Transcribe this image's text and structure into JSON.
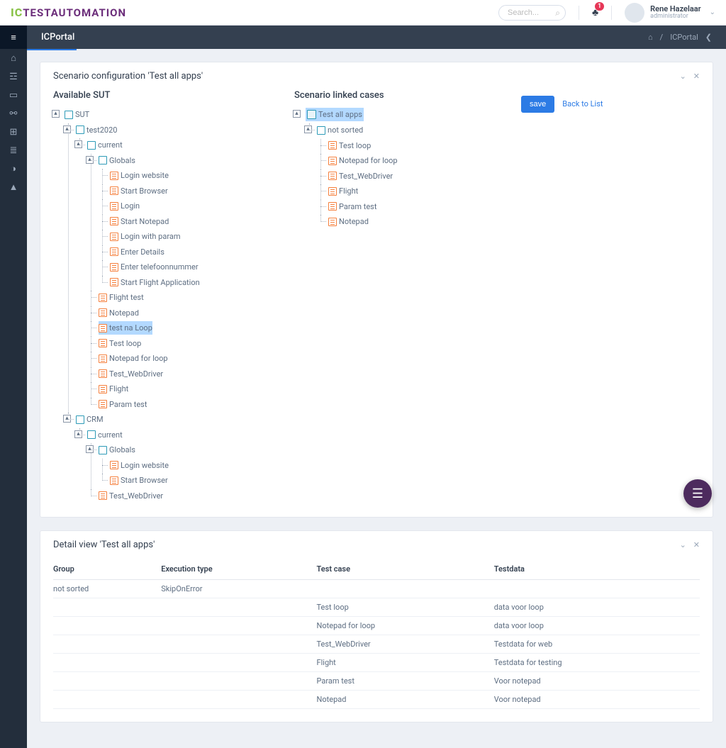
{
  "brand": {
    "ic": "IC",
    "text": "TESTAUTOMATION"
  },
  "search": {
    "placeholder": "Search..."
  },
  "notifications": {
    "count": "1"
  },
  "user": {
    "name": "Rene Hazelaar",
    "role": "administrator"
  },
  "page": {
    "title": "ICPortal"
  },
  "breadcrumb": {
    "home": "⌂",
    "sep": "/",
    "current": "ICPortal"
  },
  "card1": {
    "title": "Scenario configuration 'Test all apps'"
  },
  "avail": {
    "title": "Available SUT",
    "root": "SUT",
    "n1": "test2020",
    "n2": "current",
    "n3": "Globals",
    "g": [
      "Login website",
      "Start Browser",
      "Login",
      "Start Notepad",
      "Login with param",
      "Enter Details",
      "Enter telefoonnummer",
      "Start Flight Application"
    ],
    "c": [
      "Flight test",
      "Notepad",
      "test na Loop",
      "Test loop",
      "Notepad for loop",
      "Test_WebDriver",
      "Flight",
      "Param test"
    ],
    "crm": "CRM",
    "crm_cur": "current",
    "crm_glob": "Globals",
    "crm_g": [
      "Login website",
      "Start Browser"
    ],
    "crm_c": "Test_WebDriver"
  },
  "linked": {
    "title": "Scenario linked cases",
    "root": "Test all apps",
    "group": "not sorted",
    "items": [
      "Test loop",
      "Notepad for loop",
      "Test_WebDriver",
      "Flight",
      "Param test",
      "Notepad"
    ]
  },
  "actions": {
    "save": "save",
    "back": "Back to List"
  },
  "card2": {
    "title": "Detail view 'Test all apps'"
  },
  "table": {
    "headers": {
      "group": "Group",
      "exec": "Execution type",
      "case": "Test case",
      "data": "Testdata"
    },
    "rows": [
      {
        "group": "not sorted",
        "exec": "SkipOnError",
        "case": "",
        "data": ""
      },
      {
        "group": "",
        "exec": "",
        "case": "Test loop",
        "data": "data voor loop"
      },
      {
        "group": "",
        "exec": "",
        "case": "Notepad for loop",
        "data": "data voor loop"
      },
      {
        "group": "",
        "exec": "",
        "case": "Test_WebDriver",
        "data": "Testdata for web"
      },
      {
        "group": "",
        "exec": "",
        "case": "Flight",
        "data": "Testdata for testing"
      },
      {
        "group": "",
        "exec": "",
        "case": "Param test",
        "data": "Voor notepad"
      },
      {
        "group": "",
        "exec": "",
        "case": "Notepad",
        "data": "Voor notepad"
      }
    ]
  }
}
